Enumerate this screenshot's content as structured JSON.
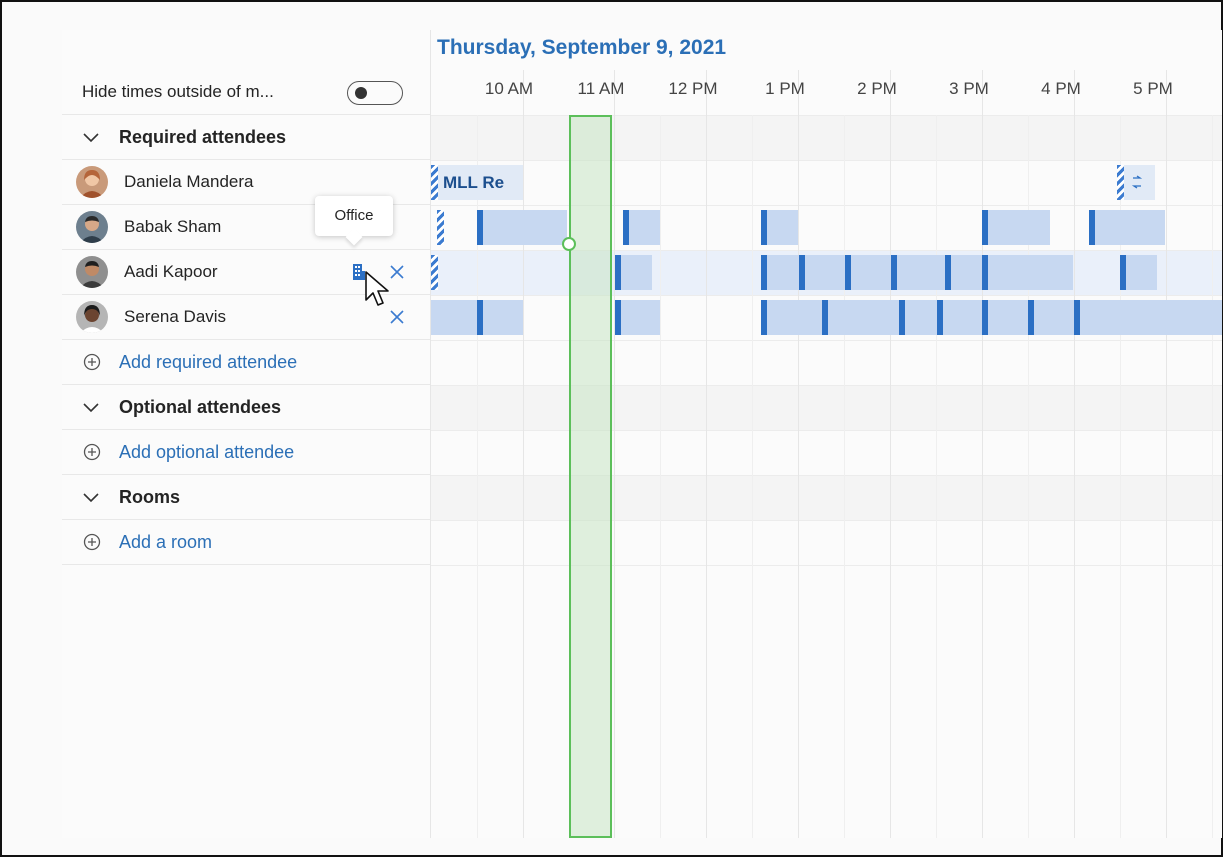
{
  "scheduler": {
    "date": "Thursday, September 9, 2021",
    "hide_times_label": "Hide times outside of m...",
    "hide_times_toggle": "off",
    "times": [
      "10 AM",
      "11 AM",
      "12 PM",
      "1 PM",
      "2 PM",
      "3 PM",
      "4 PM",
      "5 PM"
    ]
  },
  "sections": {
    "required": {
      "label": "Required attendees",
      "attendees": [
        {
          "name": "Daniela Mandera",
          "avatar_icon": "avatar-photo",
          "event_title": "MLL Re"
        },
        {
          "name": "Babak Sham",
          "avatar_icon": "avatar-photo"
        },
        {
          "name": "Aadi Kapoor",
          "avatar_icon": "avatar-photo",
          "location_icon": "building-icon"
        },
        {
          "name": "Serena Davis",
          "avatar_icon": "avatar-photo"
        }
      ],
      "add_label": "Add required attendee"
    },
    "optional": {
      "label": "Optional attendees",
      "add_label": "Add optional attendee"
    },
    "rooms": {
      "label": "Rooms",
      "add_label": "Add a room"
    }
  },
  "tooltip": {
    "text": "Office"
  },
  "colors": {
    "accent": "#2b6fb6",
    "busy": "#c7d8f1",
    "busy_marker": "#2b6fc4",
    "selection": "#5cbf5a"
  }
}
